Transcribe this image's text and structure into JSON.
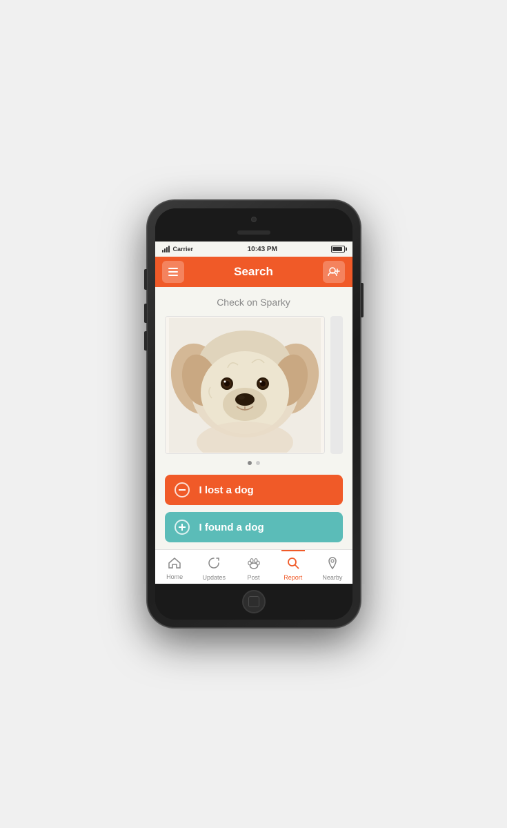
{
  "status_bar": {
    "carrier": "Carrier",
    "time": "10:43 PM"
  },
  "header": {
    "title": "Search",
    "menu_label": "menu",
    "add_label": "+👤"
  },
  "main": {
    "subtitle": "Check on Sparky",
    "lost_button_label": "I lost a dog",
    "found_button_label": "I found a dog"
  },
  "tabs": [
    {
      "id": "home",
      "label": "Home",
      "icon": "🏠",
      "active": false
    },
    {
      "id": "updates",
      "label": "Updates",
      "icon": "↻",
      "active": false
    },
    {
      "id": "post",
      "label": "Post",
      "icon": "🐾",
      "active": false
    },
    {
      "id": "report",
      "label": "Report",
      "icon": "🔍",
      "active": true
    },
    {
      "id": "nearby",
      "label": "Nearby",
      "icon": "📍",
      "active": false
    }
  ],
  "colors": {
    "orange": "#f05a28",
    "teal": "#5bbcb8",
    "active_tab": "#f05a28"
  }
}
